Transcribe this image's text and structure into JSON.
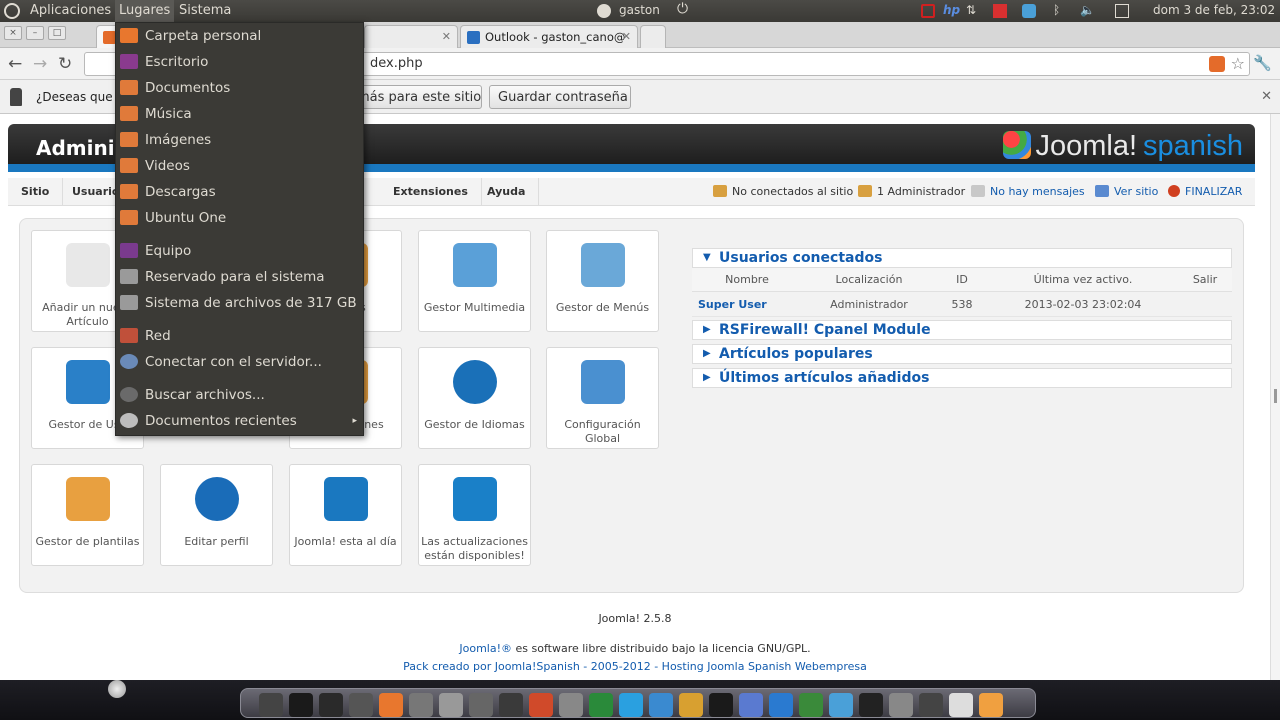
{
  "topbar": {
    "menus": [
      "Aplicaciones",
      "Lugares",
      "Sistema"
    ],
    "user": "gaston",
    "datetime": "dom  3 de feb, 23:02"
  },
  "browser": {
    "tabs": [
      {
        "label": "W"
      },
      {
        "label": ""
      },
      {
        "label": "Outlook - gaston_cano@"
      }
    ],
    "url_visible": "dex.php",
    "infobar": {
      "question": "¿Deseas que",
      "never_label": "más para este sitio",
      "save_label": "Guardar contraseña"
    }
  },
  "joomla": {
    "header_title": "Adminis",
    "logo_text": "Joomla!",
    "logo_suffix": "spanish",
    "menu": [
      "Sitio",
      "Usuarios",
      "Extensiones",
      "Ayuda"
    ],
    "status": {
      "offline": "No conectados al sitio",
      "admins": "1 Administrador",
      "messages": "No hay mensajes",
      "view_site": "Ver sitio",
      "logout": "FINALIZAR"
    },
    "quickicons": [
      {
        "label": "Añadir un nuevo Artículo",
        "icon": "add-article-icon"
      },
      {
        "label": "egorías",
        "icon": "categories-icon"
      },
      {
        "label": "Gestor Multimedia",
        "icon": "media-icon"
      },
      {
        "label": "Gestor de Menús",
        "icon": "menu-icon"
      },
      {
        "label": "Gestor de Usu",
        "icon": "users-icon"
      },
      {
        "label": "e extensiones",
        "icon": "extensions-icon"
      },
      {
        "label": "Gestor de Idiomas",
        "icon": "language-icon"
      },
      {
        "label": "Configuración Global",
        "icon": "config-icon"
      },
      {
        "label": "Gestor de plantilas",
        "icon": "template-icon"
      },
      {
        "label": "Editar perfil",
        "icon": "info-icon"
      },
      {
        "label": "Joomla! esta al día",
        "icon": "joomla-ok-icon"
      },
      {
        "label": "Las actualizaciones están disponibles!",
        "icon": "update-icon"
      }
    ],
    "modules": {
      "users_online": {
        "title": "Usuarios conectados",
        "columns": [
          "Nombre",
          "Localización",
          "ID",
          "Última vez activo.",
          "Salir"
        ],
        "rows": [
          [
            "Super User",
            "Administrador",
            "538",
            "2013-02-03 23:02:04",
            ""
          ]
        ]
      },
      "others": [
        "RSFirewall! Cpanel Module",
        "Artículos populares",
        "Últimos artículos añadidos"
      ]
    },
    "footer": {
      "version": "Joomla! 2.5.8",
      "license_link": "Joomla!®",
      "license_text": " es software libre distribuido bajo la licencia GNU/GPL.",
      "pack": "Pack creado por Joomla!Spanish - 2005-2012 - Hosting Joomla Spanish Webempresa"
    }
  },
  "places_menu": [
    {
      "label": "Carpeta personal",
      "icon": "home-folder-icon",
      "color": "#e8772e"
    },
    {
      "label": "Escritorio",
      "icon": "desktop-icon",
      "color": "#8a3a8e"
    },
    {
      "label": "Documentos",
      "icon": "documents-folder-icon",
      "color": "#e07a3a"
    },
    {
      "label": "Música",
      "icon": "music-folder-icon",
      "color": "#e07a3a"
    },
    {
      "label": "Imágenes",
      "icon": "pictures-folder-icon",
      "color": "#e07a3a"
    },
    {
      "label": "Videos",
      "icon": "videos-folder-icon",
      "color": "#e07a3a"
    },
    {
      "label": "Descargas",
      "icon": "downloads-folder-icon",
      "color": "#e07a3a"
    },
    {
      "label": "Ubuntu One",
      "icon": "ubuntu-one-folder-icon",
      "color": "#e07a3a"
    },
    {
      "label": "Equipo",
      "icon": "computer-icon",
      "color": "#7a3a8e"
    },
    {
      "label": "Reservado para el sistema",
      "icon": "drive-icon",
      "color": "#9a9a9a"
    },
    {
      "label": "Sistema de archivos de 317 GB",
      "icon": "drive-icon",
      "color": "#9a9a9a"
    },
    {
      "label": "Red",
      "icon": "network-icon",
      "color": "#c0503a"
    },
    {
      "label": "Conectar con el servidor...",
      "icon": "globe-icon",
      "color": "#6a8ab8"
    },
    {
      "label": "Buscar archivos...",
      "icon": "search-icon",
      "color": "#6a6a6a"
    },
    {
      "label": "Documentos recientes",
      "icon": "recent-icon",
      "color": "#bdbdbd"
    }
  ],
  "colors": {
    "joomla_blue": "#1a78c0",
    "link_blue": "#135cae",
    "panel_bg": "#3b3a36"
  }
}
